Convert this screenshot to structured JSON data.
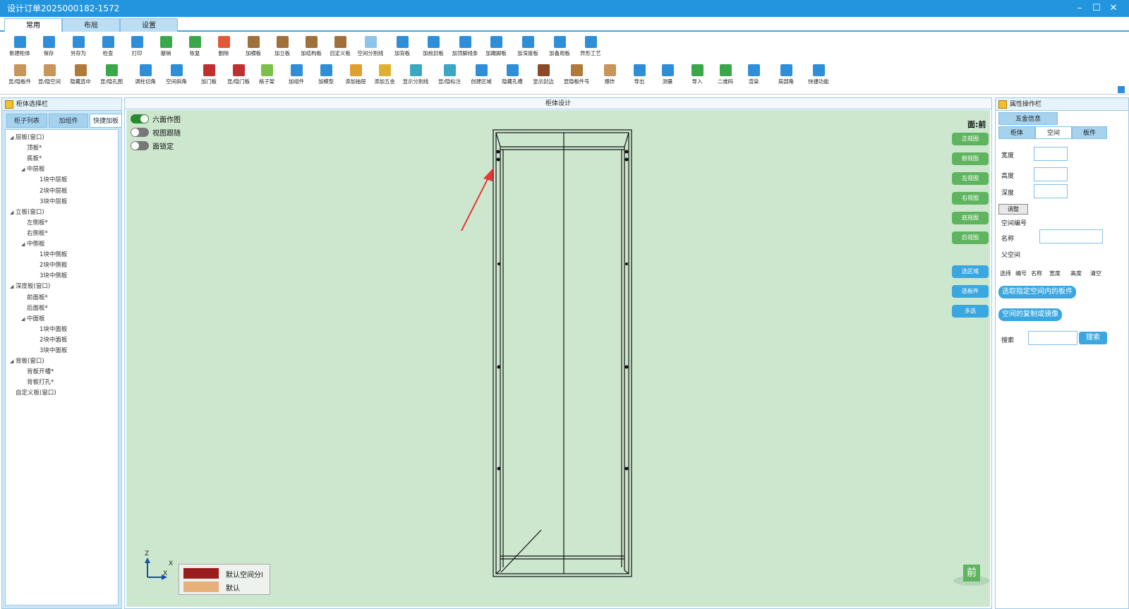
{
  "window": {
    "title": "设计订单2025000182-1572",
    "min": "–",
    "max": "☐",
    "close": "✕"
  },
  "tabs": [
    "常用",
    "布局",
    "设置"
  ],
  "ribbon_row1": [
    {
      "label": "新建柜体",
      "color": "#2e8fd8"
    },
    {
      "label": "保存",
      "color": "#2e8fd8"
    },
    {
      "label": "另存为",
      "color": "#2e8fd8"
    },
    {
      "label": "检查",
      "color": "#2e8fd8"
    },
    {
      "label": "打印",
      "color": "#2e8fd8"
    },
    {
      "label": "撤销",
      "color": "#3aa84a"
    },
    {
      "label": "恢复",
      "color": "#3aa84a"
    },
    {
      "label": "删除",
      "color": "#e05a3a"
    },
    {
      "label": "加横板",
      "color": "#a0703a"
    },
    {
      "label": "加立板",
      "color": "#a0703a"
    },
    {
      "label": "加结构板",
      "color": "#a0703a"
    },
    {
      "label": "自定义板",
      "color": "#a0703a"
    },
    {
      "label": "空间分割线",
      "color": "#8ec4ea"
    },
    {
      "label": "加背板",
      "color": "#2e8fd8"
    },
    {
      "label": "加前封板",
      "color": "#2e8fd8"
    },
    {
      "label": "加顶脚线条",
      "color": "#2e8fd8"
    },
    {
      "label": "加踢脚板",
      "color": "#2e8fd8"
    },
    {
      "label": "加深度板",
      "color": "#2e8fd8"
    },
    {
      "label": "加备用板",
      "color": "#2e8fd8"
    },
    {
      "label": "异形工艺",
      "color": "#2e8fd8"
    }
  ],
  "ribbon_row2": [
    {
      "label": "显/隐板件",
      "color": "#c8955a"
    },
    {
      "label": "显/隐空间",
      "color": "#c8955a"
    },
    {
      "label": "隐藏选中",
      "color": "#b07a3a"
    },
    {
      "label": "显/隐孔图",
      "color": "#3aa84a"
    },
    {
      "label": "调柱切角",
      "color": "#2e8fd8"
    },
    {
      "label": "空间斜角",
      "color": "#2e8fd8"
    },
    {
      "label": "加门板",
      "color": "#c03030"
    },
    {
      "label": "显/隐门板",
      "color": "#c03030"
    },
    {
      "label": "格子架",
      "color": "#7ac04a"
    },
    {
      "label": "加组件",
      "color": "#2e8fd8"
    },
    {
      "label": "加模型",
      "color": "#2e8fd8"
    },
    {
      "label": "添加抽屉",
      "color": "#e0a030"
    },
    {
      "label": "添加五金",
      "color": "#e0b030"
    },
    {
      "label": "显示分割线",
      "color": "#3aa8c0"
    },
    {
      "label": "显/隐标注",
      "color": "#3aa8c0"
    },
    {
      "label": "创建区域",
      "color": "#2e8fd8"
    },
    {
      "label": "隐藏孔槽",
      "color": "#2e8fd8"
    },
    {
      "label": "显示封边",
      "color": "#8a4a2a"
    },
    {
      "label": "显隐板件号",
      "color": "#b07a3a"
    },
    {
      "label": "爆炸",
      "color": "#c8955a"
    },
    {
      "label": "导出",
      "color": "#2e8fd8"
    },
    {
      "label": "测量",
      "color": "#2e8fd8"
    },
    {
      "label": "导入",
      "color": "#3aa84a"
    },
    {
      "label": "二维码",
      "color": "#3aa84a"
    },
    {
      "label": "渲染",
      "color": "#2e8fd8"
    },
    {
      "label": "局部角",
      "color": "#2e8fd8"
    },
    {
      "label": "快捷功能",
      "color": "#2e8fd8"
    }
  ],
  "left": {
    "title": "柜体选择栏",
    "tabs": [
      "柜子列表",
      "加组件",
      "快捷加板"
    ],
    "tree": [
      {
        "text": "层板(窗口)",
        "lvl": 0,
        "ar": "◢"
      },
      {
        "text": "顶板*",
        "lvl": 1
      },
      {
        "text": "底板*",
        "lvl": 1
      },
      {
        "text": "中层板",
        "lvl": 1,
        "ar": "◢"
      },
      {
        "text": "1块中层板",
        "lvl": 2
      },
      {
        "text": "2块中层板",
        "lvl": 2
      },
      {
        "text": "3块中层板",
        "lvl": 2
      },
      {
        "text": "立板(窗口)",
        "lvl": 0,
        "ar": "◢"
      },
      {
        "text": "左侧板*",
        "lvl": 1
      },
      {
        "text": "右侧板*",
        "lvl": 1
      },
      {
        "text": "中侧板",
        "lvl": 1,
        "ar": "◢"
      },
      {
        "text": "1块中侧板",
        "lvl": 2
      },
      {
        "text": "2块中侧板",
        "lvl": 2
      },
      {
        "text": "3块中侧板",
        "lvl": 2
      },
      {
        "text": "深度板(窗口)",
        "lvl": 0,
        "ar": "◢"
      },
      {
        "text": "前面板*",
        "lvl": 1
      },
      {
        "text": "后面板*",
        "lvl": 1
      },
      {
        "text": "中面板",
        "lvl": 1,
        "ar": "◢"
      },
      {
        "text": "1块中面板",
        "lvl": 2
      },
      {
        "text": "2块中面板",
        "lvl": 2
      },
      {
        "text": "3块中面板",
        "lvl": 2
      },
      {
        "text": "背板(窗口)",
        "lvl": 0,
        "ar": "◢"
      },
      {
        "text": "背板开槽*",
        "lvl": 1
      },
      {
        "text": "背板打孔*",
        "lvl": 1
      },
      {
        "text": "自定义板(窗口)",
        "lvl": 0
      }
    ]
  },
  "center": {
    "title": "柜体设计",
    "toggles": [
      {
        "label": "六面作图",
        "on": true
      },
      {
        "label": "视图跟随",
        "on": false
      },
      {
        "label": "面锁定",
        "on": false
      }
    ],
    "face_label": "面:前",
    "view_buttons": [
      "正视图",
      "俯视图",
      "左视图",
      "右视图",
      "底视图",
      "后视图"
    ],
    "action_buttons": [
      "选区域",
      "选板件",
      "多选"
    ],
    "legend": [
      {
        "label": "默认空间分l",
        "color": "#9b1c1c"
      },
      {
        "label": "默认",
        "color": "#e7b07a"
      }
    ],
    "axis": {
      "z": "Z",
      "x": "X",
      "x2": "X"
    },
    "face_cube": "前"
  },
  "right": {
    "title": "属性操作栏",
    "top_tab": "五金信息",
    "tabs": [
      "柜体",
      "空间",
      "板件"
    ],
    "width_label": "宽度",
    "height_label": "高度",
    "depth_label": "深度",
    "adjust_btn": "调整",
    "space_no_label": "空间编号",
    "name_label": "名称",
    "parent_label": "父空间",
    "columns": [
      "选择",
      "编号",
      "名称",
      "宽度",
      "高度",
      "清空"
    ],
    "btn_select": "选取指定空间内的板件",
    "btn_copy": "空间的复制或镜像",
    "search_label": "搜索",
    "search_btn": "搜索"
  }
}
